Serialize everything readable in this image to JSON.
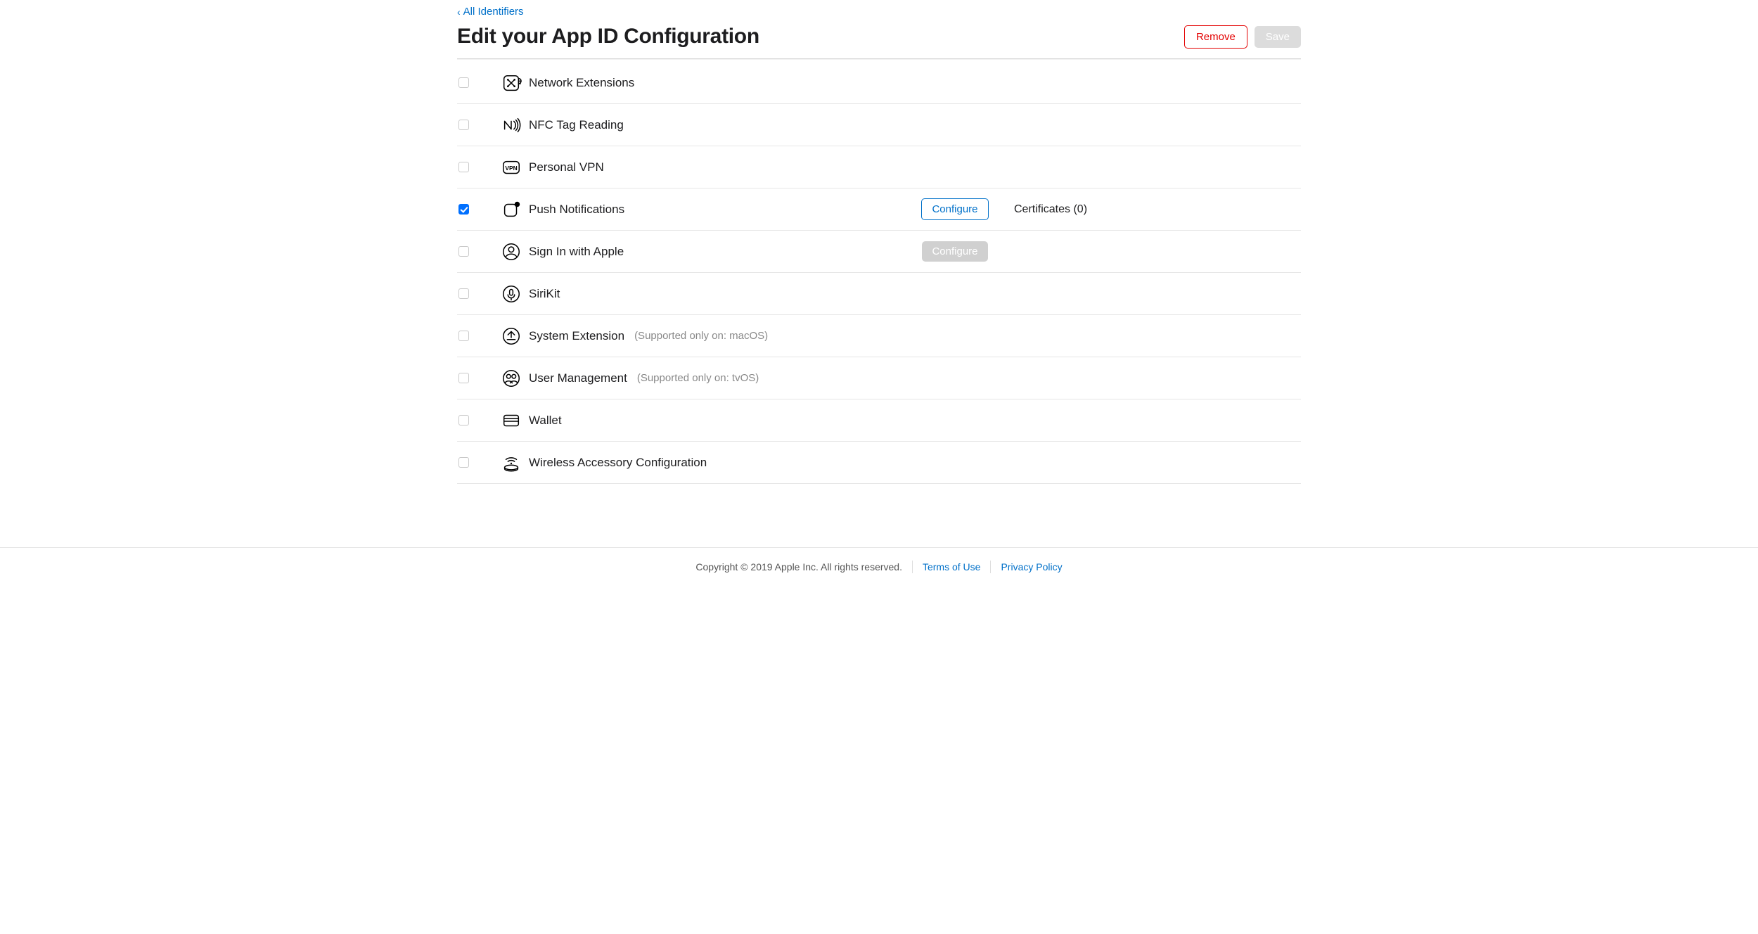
{
  "back_link": "All Identifiers",
  "title": "Edit your App ID Configuration",
  "buttons": {
    "remove": "Remove",
    "save": "Save",
    "configure": "Configure"
  },
  "capabilities": [
    {
      "key": "network-extensions",
      "name": "Network Extensions",
      "checked": false,
      "icon": "network",
      "note": "",
      "config": "none",
      "extra": ""
    },
    {
      "key": "nfc-tag-reading",
      "name": "NFC Tag Reading",
      "checked": false,
      "icon": "nfc",
      "note": "",
      "config": "none",
      "extra": ""
    },
    {
      "key": "personal-vpn",
      "name": "Personal VPN",
      "checked": false,
      "icon": "vpn",
      "note": "",
      "config": "none",
      "extra": ""
    },
    {
      "key": "push-notifications",
      "name": "Push Notifications",
      "checked": true,
      "icon": "push",
      "note": "",
      "config": "enabled",
      "extra": "Certificates (0)"
    },
    {
      "key": "sign-in-with-apple",
      "name": "Sign In with Apple",
      "checked": false,
      "icon": "signin",
      "note": "",
      "config": "disabled",
      "extra": ""
    },
    {
      "key": "sirikit",
      "name": "SiriKit",
      "checked": false,
      "icon": "siri",
      "note": "",
      "config": "none",
      "extra": ""
    },
    {
      "key": "system-extension",
      "name": "System Extension",
      "checked": false,
      "icon": "sysext",
      "note": "(Supported only on: macOS)",
      "config": "none",
      "extra": ""
    },
    {
      "key": "user-management",
      "name": "User Management",
      "checked": false,
      "icon": "users",
      "note": "(Supported only on: tvOS)",
      "config": "none",
      "extra": ""
    },
    {
      "key": "wallet",
      "name": "Wallet",
      "checked": false,
      "icon": "wallet",
      "note": "",
      "config": "none",
      "extra": ""
    },
    {
      "key": "wireless-accessory",
      "name": "Wireless Accessory Configuration",
      "checked": false,
      "icon": "wireless",
      "note": "",
      "config": "none",
      "extra": ""
    }
  ],
  "footer": {
    "copyright": "Copyright © 2019 Apple Inc. All rights reserved.",
    "terms": "Terms of Use",
    "privacy": "Privacy Policy"
  }
}
